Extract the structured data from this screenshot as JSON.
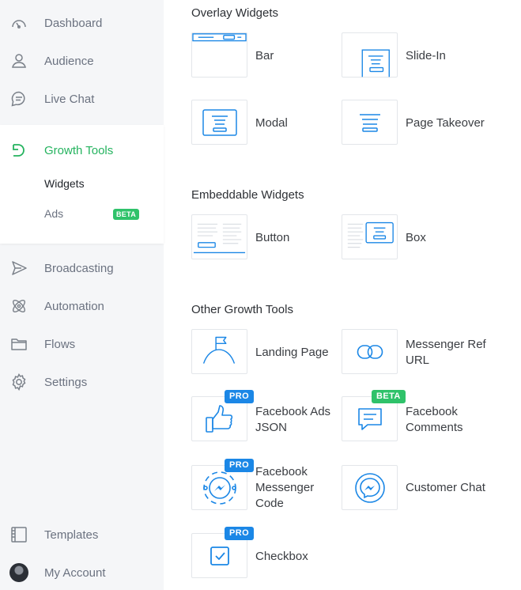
{
  "colors": {
    "accent_blue": "#1b87e6",
    "accent_green": "#25b35f",
    "sidebar_bg": "#f5f6f8"
  },
  "sidebar": {
    "items": [
      {
        "label": "Dashboard",
        "icon": "dashboard-gauge-icon"
      },
      {
        "label": "Audience",
        "icon": "person-icon"
      },
      {
        "label": "Live Chat",
        "icon": "chat-bubble-icon"
      },
      {
        "label": "Growth Tools",
        "icon": "growth-tools-icon"
      },
      {
        "label": "Broadcasting",
        "icon": "send-icon"
      },
      {
        "label": "Automation",
        "icon": "atom-icon"
      },
      {
        "label": "Flows",
        "icon": "folder-icon"
      },
      {
        "label": "Settings",
        "icon": "gear-icon"
      },
      {
        "label": "Templates",
        "icon": "template-icon"
      },
      {
        "label": "My Account",
        "icon": "avatar"
      }
    ],
    "subitems": [
      {
        "label": "Widgets"
      },
      {
        "label": "Ads",
        "badge": "BETA"
      }
    ]
  },
  "sections": {
    "overlay": {
      "title": "Overlay Widgets",
      "items": [
        {
          "label": "Bar",
          "icon": "bar-widget-icon"
        },
        {
          "label": "Slide-In",
          "icon": "slide-in-icon"
        },
        {
          "label": "Modal",
          "icon": "modal-icon"
        },
        {
          "label": "Page Takeover",
          "icon": "page-takeover-icon"
        }
      ]
    },
    "embeddable": {
      "title": "Embeddable Widgets",
      "items": [
        {
          "label": "Button",
          "icon": "button-widget-icon"
        },
        {
          "label": "Box",
          "icon": "box-widget-icon"
        }
      ]
    },
    "other": {
      "title": "Other Growth Tools",
      "items": [
        {
          "label": "Landing Page",
          "icon": "landing-page-flag-icon"
        },
        {
          "label_line1": "Messenger Ref",
          "label_line2": "URL",
          "icon": "link-icon"
        },
        {
          "label_line1": "Facebook Ads",
          "label_line2": "JSON",
          "icon": "thumbs-up-icon",
          "badge": "PRO"
        },
        {
          "label_line1": "Facebook",
          "label_line2": "Comments",
          "icon": "comment-icon",
          "badge": "BETA"
        },
        {
          "label_line1": "Facebook",
          "label_line2": "Messenger",
          "label_line3": "Code",
          "icon": "messenger-code-icon",
          "badge": "PRO"
        },
        {
          "label": "Customer Chat",
          "icon": "messenger-icon"
        },
        {
          "label": "Checkbox",
          "icon": "checkbox-icon",
          "badge": "PRO"
        }
      ]
    }
  }
}
